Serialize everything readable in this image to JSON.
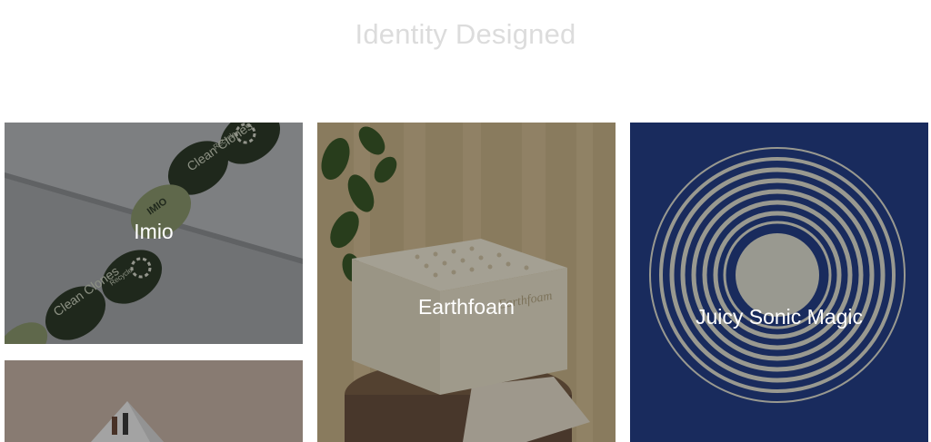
{
  "page": {
    "heading": "Identity Designed",
    "heading_color": "#dcdcdc"
  },
  "projects": [
    {
      "title": "Imio",
      "icon": "clean-clones-sticker-image"
    },
    {
      "title": "Earthfoam",
      "icon": "foam-cube-image"
    },
    {
      "title": "Juicy Sonic Magic",
      "icon": "concentric-rings-image"
    },
    {
      "title": "",
      "icon": "product-photo-image"
    }
  ],
  "imagery": {
    "imio_sticker_brand": "IMIO",
    "imio_sticker_text": "Clean Clones",
    "imio_sticker_small": "Recycle",
    "earthfoam_emboss": "Earthfoam"
  },
  "colors": {
    "imio_bg": "#6b6e72",
    "imio_sticker": "#2f3b2a",
    "imio_sticker_light": "#8d9a6f",
    "earthfoam_bg": "#6e5c3e",
    "juicy_bg": "#1b2f63",
    "juicy_rings": "#cfcfc0"
  }
}
